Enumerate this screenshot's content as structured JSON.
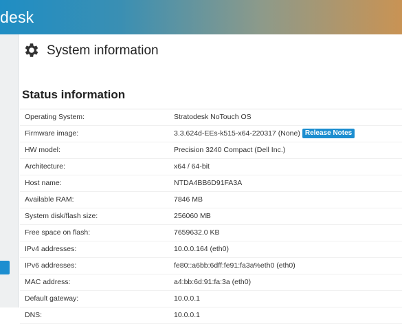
{
  "app": {
    "brand_partial": "desk"
  },
  "page": {
    "title": "System information"
  },
  "section": {
    "title": "Status information"
  },
  "status_rows": [
    {
      "label": "Operating System:",
      "value": "Stratodesk NoTouch OS"
    },
    {
      "label": "Firmware image:",
      "value": "3.3.624d-EEs-k515-x64-220317 (None)",
      "button": "Release Notes"
    },
    {
      "label": "HW model:",
      "value": "Precision 3240 Compact (Dell Inc.)"
    },
    {
      "label": "Architecture:",
      "value": "x64 / 64-bit"
    },
    {
      "label": "Host name:",
      "value": "NTDA4BB6D91FA3A"
    },
    {
      "label": "Available RAM:",
      "value": "7846 MB"
    },
    {
      "label": "System disk/flash size:",
      "value": "256060 MB"
    },
    {
      "label": "Free space on flash:",
      "value": "7659632.0 KB"
    },
    {
      "label": "IPv4 addresses:",
      "value": "10.0.0.164 (eth0)"
    },
    {
      "label": "IPv6 addresses:",
      "value": "fe80::a6bb:6dff:fe91:fa3a%eth0 (eth0)"
    },
    {
      "label": "MAC address:",
      "value": "a4:bb:6d:91:fa:3a (eth0)"
    },
    {
      "label": "Default gateway:",
      "value": "10.0.0.1"
    },
    {
      "label": "DNS:",
      "value": "10.0.0.1"
    }
  ],
  "icons": {
    "page_icon": "gear-icon"
  }
}
